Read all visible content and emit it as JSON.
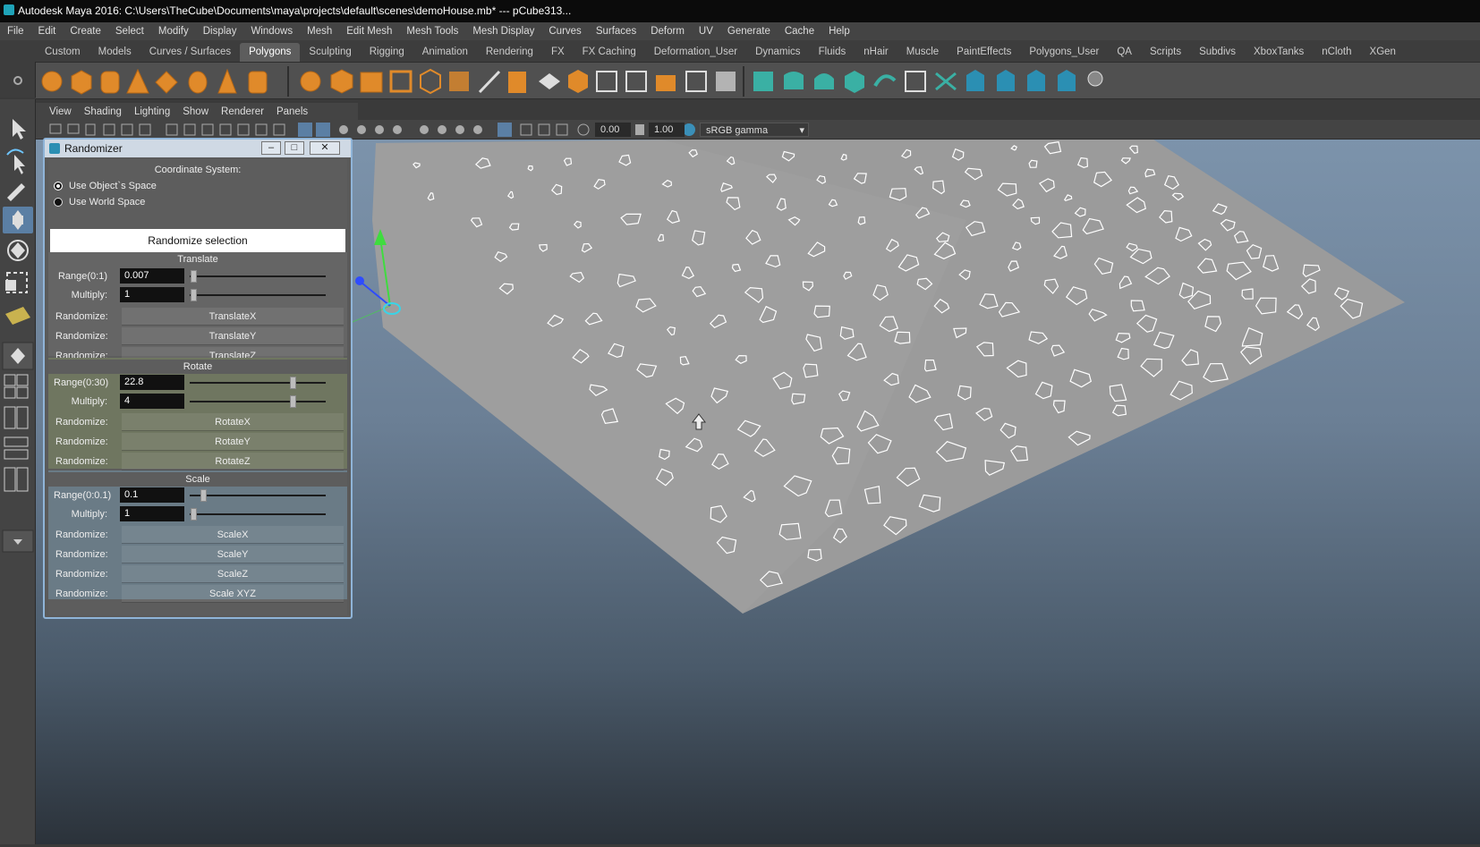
{
  "window": {
    "title": "Autodesk Maya 2016: C:\\Users\\TheCube\\Documents\\maya\\projects\\default\\scenes\\demoHouse.mb*   ---   pCube313..."
  },
  "menubar": [
    "File",
    "Edit",
    "Create",
    "Select",
    "Modify",
    "Display",
    "Windows",
    "Mesh",
    "Edit Mesh",
    "Mesh Tools",
    "Mesh Display",
    "Curves",
    "Surfaces",
    "Deform",
    "UV",
    "Generate",
    "Cache",
    "Help"
  ],
  "shelf_tabs": {
    "items": [
      "Custom",
      "Models",
      "Curves / Surfaces",
      "Polygons",
      "Sculpting",
      "Rigging",
      "Animation",
      "Rendering",
      "FX",
      "FX Caching",
      "Deformation_User",
      "Dynamics",
      "Fluids",
      "nHair",
      "Muscle",
      "PaintEffects",
      "Polygons_User",
      "QA",
      "Scripts",
      "Subdivs",
      "XboxTanks",
      "nCloth",
      "XGen"
    ],
    "active": "Polygons"
  },
  "panel_menu": [
    "View",
    "Shading",
    "Lighting",
    "Show",
    "Renderer",
    "Panels"
  ],
  "panel_toolbar": {
    "exposure": "0.00",
    "gamma": "1.00",
    "color_space": "sRGB gamma"
  },
  "colors": {
    "shelf_orange": "#e08a2a",
    "shelf_teal": "#3ab0a4",
    "dialog_border": "#8fb4d8",
    "rotate_band": "#6f7660",
    "scale_band": "#6a7b86",
    "translate_band": "#656565"
  },
  "dialog": {
    "title": "Randomizer",
    "coord_label": "Coordinate System:",
    "option_object": "Use Object`s Space",
    "option_world": "Use World Space",
    "selected_option": "object",
    "randomize_selection": "Randomize selection",
    "randomize_label": "Randomize:",
    "translate": {
      "header": "Translate",
      "range_label": "Range(0:1)",
      "range_value": "0.007",
      "multiply_label": "Multiply:",
      "multiply_value": "1",
      "range_slider": 0.007,
      "multiply_slider": 0.01,
      "buttons": [
        "TranslateX",
        "TranslateY",
        "TranslateZ"
      ]
    },
    "rotate": {
      "header": "Rotate",
      "range_label": "Range(0:30)",
      "range_value": "22.8",
      "multiply_label": "Multiply:",
      "multiply_value": "4",
      "range_slider": 0.76,
      "multiply_slider": 0.76,
      "buttons": [
        "RotateX",
        "RotateY",
        "RotateZ"
      ]
    },
    "scale": {
      "header": "Scale",
      "range_label": "Range(0:0.1)",
      "range_value": "0.1",
      "multiply_label": "Multiply:",
      "multiply_value": "1",
      "range_slider": 0.08,
      "multiply_slider": 0.01,
      "buttons": [
        "ScaleX",
        "ScaleY",
        "ScaleZ",
        "Scale XYZ"
      ]
    }
  }
}
